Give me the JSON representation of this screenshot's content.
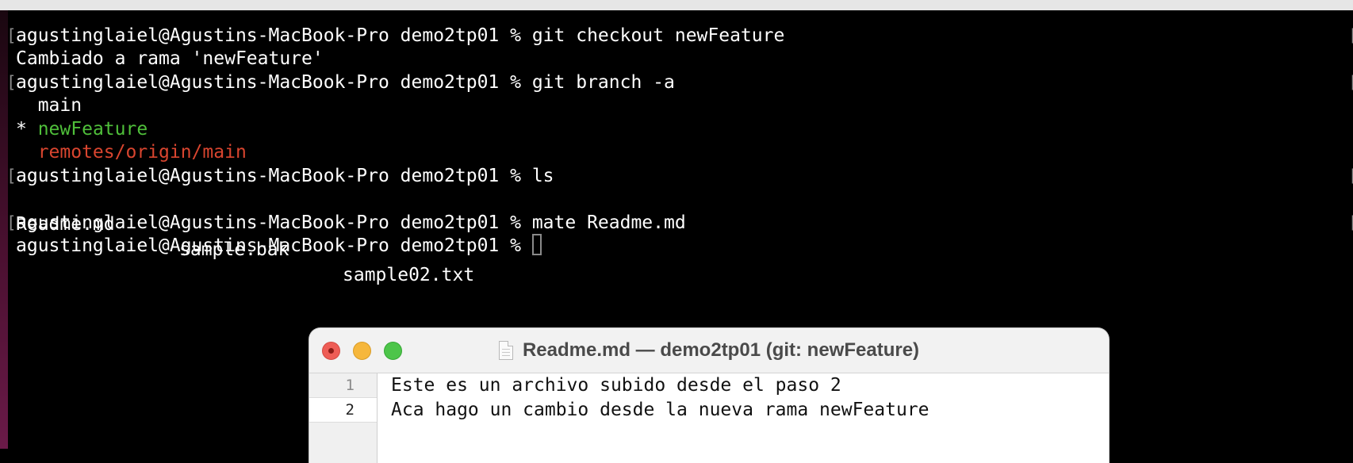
{
  "terminal": {
    "lines": [
      {
        "prompt": "agustinglaiel@Agustins-MacBook-Pro demo2tp01 % ",
        "command": "git checkout newFeature"
      },
      {
        "output": "Cambiado a rama 'newFeature'"
      },
      {
        "prompt": "agustinglaiel@Agustins-MacBook-Pro demo2tp01 % ",
        "command": "git branch -a"
      },
      {
        "output": "  main"
      },
      {
        "marker": "* ",
        "current_branch": "newFeature"
      },
      {
        "remote_branch": "  remotes/origin/main"
      },
      {
        "prompt": "agustinglaiel@Agustins-MacBook-Pro demo2tp01 % ",
        "command": "ls"
      },
      {
        "files": [
          "Readme.md",
          "sample.bak",
          "sample02.txt"
        ]
      },
      {
        "prompt": "agustinglaiel@Agustins-MacBook-Pro demo2tp01 % ",
        "command": "mate Readme.md"
      },
      {
        "prompt": "agustinglaiel@Agustins-MacBook-Pro demo2tp01 % ",
        "command": ""
      }
    ],
    "bracket_char": "[",
    "right_bracket_char": "["
  },
  "editor": {
    "title": "Readme.md — demo2tp01 (git: newFeature)",
    "lines": [
      {
        "number": "1",
        "text": "Este es un archivo subido desde el paso 2"
      },
      {
        "number": "2",
        "text": "Aca hago un cambio desde la nueva rama newFeature"
      }
    ]
  },
  "icons": [
    "document-icon",
    "close-window-icon",
    "minimize-window-icon",
    "zoom-window-icon",
    "text-cursor-icon"
  ],
  "colors": {
    "terminal_bg": "#000000",
    "terminal_fg": "#ffffff",
    "current_branch": "#4fbf3a",
    "remote_branch": "#d9452f",
    "close": "#ee5d56",
    "minimize": "#f6b73c",
    "zoom": "#4dc54a"
  }
}
